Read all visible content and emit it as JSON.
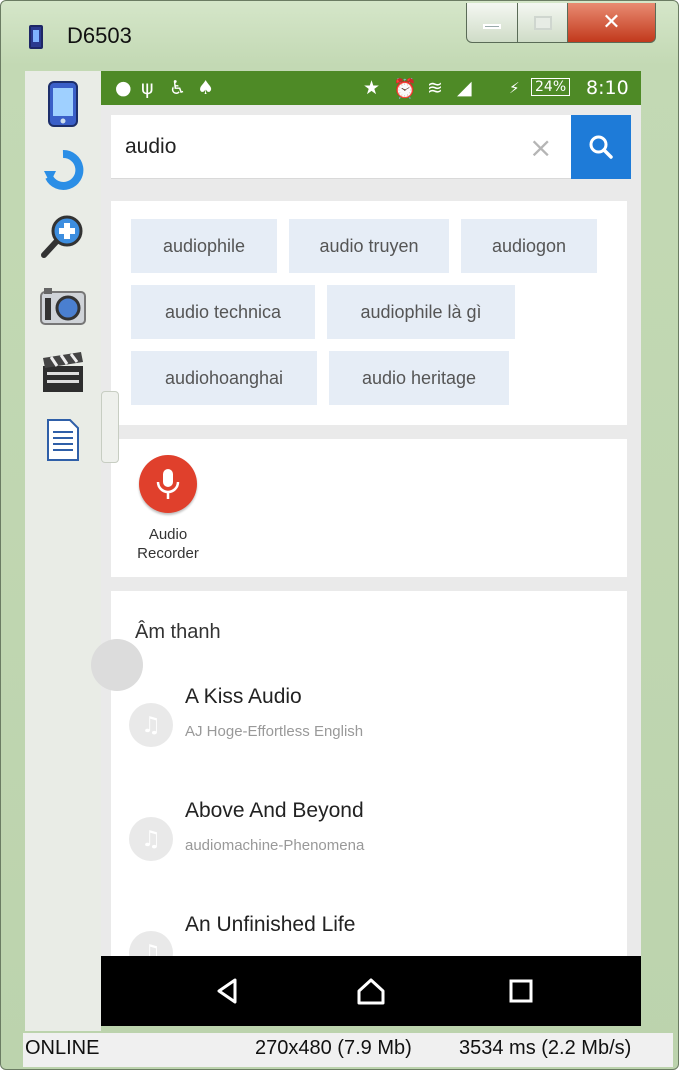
{
  "window": {
    "title": "D6503"
  },
  "toolbar": {
    "icons": [
      "phone-icon",
      "rotate-icon",
      "zoom-icon",
      "camera-icon",
      "video-icon",
      "document-icon"
    ]
  },
  "statusbar": {
    "battery": "24%",
    "time": "8:10"
  },
  "search": {
    "query": "audio",
    "clear_glyph": "×"
  },
  "suggestions": [
    "audiophile",
    "audio truyen",
    "audiogon",
    "audio technica",
    "audiophile là gì",
    "audiohoanghai",
    "audio heritage"
  ],
  "apps": [
    {
      "name": "Audio Recorder",
      "line1": "Audio",
      "line2": "Recorder",
      "color": "#e0402c"
    }
  ],
  "results": {
    "section_title": "Âm thanh",
    "items": [
      {
        "title": "A Kiss Audio",
        "subtitle": "AJ Hoge-Effortless English"
      },
      {
        "title": "Above And Beyond",
        "subtitle": "audiomachine-Phenomena"
      },
      {
        "title": "An Unfinished Life",
        "subtitle": ""
      }
    ]
  },
  "window_status": {
    "state": "ONLINE",
    "resolution": "270x480 (7.9 Mb)",
    "latency": "3534 ms (2.2 Mb/s)"
  },
  "colors": {
    "accent": "#1e7bd8",
    "statusbar": "#4e8a26",
    "chip": "#e6edf6"
  }
}
